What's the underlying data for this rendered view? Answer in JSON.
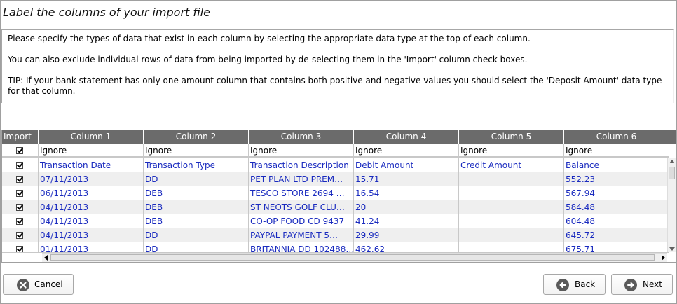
{
  "title": "Label the columns of your import file",
  "info": {
    "p1": "Please specify the types of data that exist in each column by selecting the appropriate data type at the top of each column.",
    "p2": "You can also exclude individual rows of data from being imported by de-selecting them in the 'Import' column check boxes.",
    "p3": "TIP: If your bank statement has only one amount column that contains both positive and negative values you should select the 'Deposit Amount' data type for that column."
  },
  "grid": {
    "import_header": "Import",
    "columns": [
      "Column 1",
      "Column 2",
      "Column 3",
      "Column 4",
      "Column 5",
      "Column 6"
    ],
    "types": [
      "Ignore",
      "Ignore",
      "Ignore",
      "Ignore",
      "Ignore",
      "Ignore"
    ],
    "header_row": [
      "Transaction Date",
      "Transaction Type",
      "Transaction Description",
      "Debit Amount",
      "Credit Amount",
      "Balance"
    ],
    "rows": [
      [
        "07/11/2013",
        "DD",
        "PET PLAN LTD PREM…",
        "15.71",
        "",
        "552.23"
      ],
      [
        "06/11/2013",
        "DEB",
        "TESCO STORE 2694 …",
        "16.54",
        "",
        "567.94"
      ],
      [
        "04/11/2013",
        "DEB",
        "ST NEOTS GOLF CLU…",
        "20",
        "",
        "584.48"
      ],
      [
        "04/11/2013",
        "DEB",
        "CO-OP FOOD CD 9437",
        "41.24",
        "",
        "604.48"
      ],
      [
        "04/11/2013",
        "DD",
        "PAYPAL PAYMENT 5…",
        "29.99",
        "",
        "645.72"
      ],
      [
        "01/11/2013",
        "DD",
        "BRITANNIA DD 102488…",
        "462.62",
        "",
        "675.71"
      ]
    ]
  },
  "buttons": {
    "cancel": "Cancel",
    "back": "Back",
    "next": "Next"
  },
  "icons": {
    "cancel": "close-circle-icon",
    "back": "arrow-left-circle-icon",
    "next": "arrow-right-circle-icon"
  }
}
